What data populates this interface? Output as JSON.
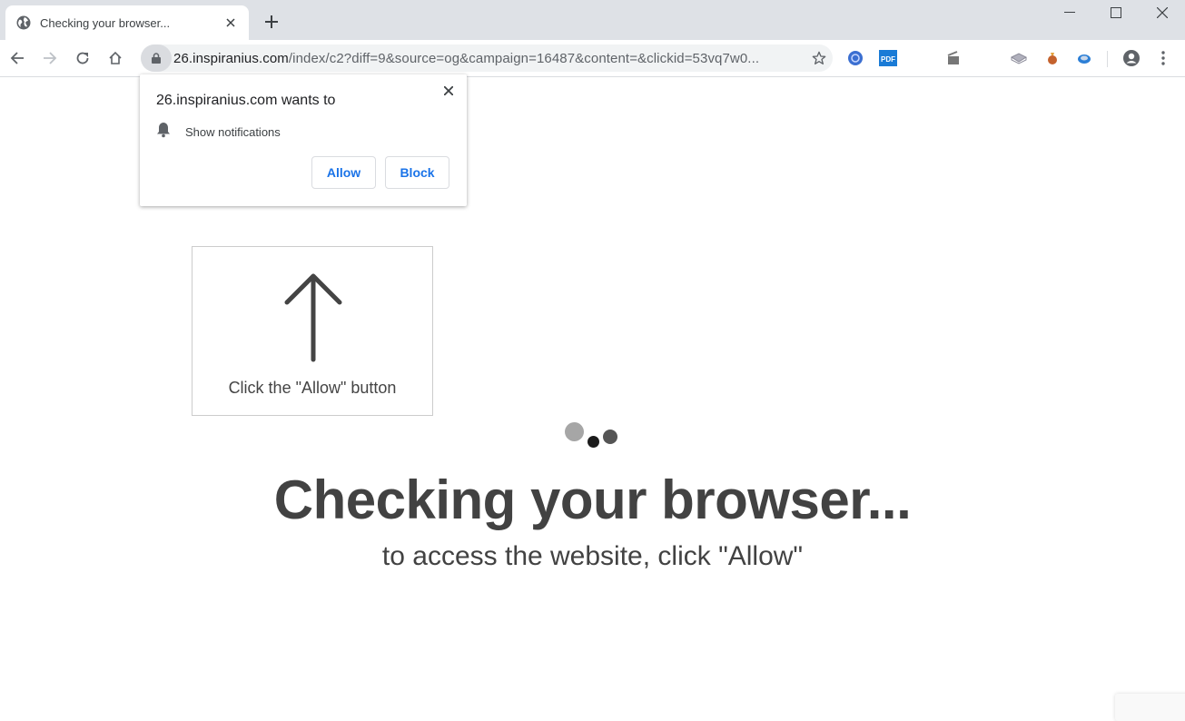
{
  "browser": {
    "tab": {
      "title": "Checking your browser...",
      "favicon": "globe-icon",
      "close_icon": "close-icon"
    },
    "new_tab_icon": "plus-icon",
    "window_controls": [
      "minimize-icon",
      "maximize-icon",
      "close-icon"
    ],
    "nav": [
      "back-icon",
      "forward-icon",
      "reload-icon",
      "home-icon"
    ],
    "address_bar": {
      "security_icon": "lock-icon",
      "host": "26.inspiranius.com",
      "path": "/index/c2?diff=9&source=og&campaign=16487&content=&clickid=53vq7w0...",
      "bookmark_icon": "star-icon"
    },
    "extensions": [
      {
        "name": "blue-globe-extension-icon",
        "color": "#3b6fd1"
      },
      {
        "name": "pdf-extension-icon",
        "label": "PDF",
        "color": "#1a7bd6"
      },
      {
        "name": "clapperboard-extension-icon",
        "color": "#777777"
      },
      {
        "name": "gray-box-extension-icon",
        "color": "#9a9aa8"
      },
      {
        "name": "money-bag-extension-icon",
        "color": "#c4622d"
      },
      {
        "name": "blue-disc-extension-icon",
        "color": "#2c7fd6"
      }
    ],
    "profile_icon": "account-circle-icon",
    "menu_icon": "kebab-menu-icon"
  },
  "permission_popup": {
    "title": "26.inspiranius.com wants to",
    "permission_icon": "bell-icon",
    "permission_label": "Show notifications",
    "allow_label": "Allow",
    "block_label": "Block",
    "accent_color": "#1a73e8"
  },
  "page": {
    "hint_text": "Click the \"Allow\" button",
    "headline": "Checking your browser...",
    "subtext": "to access the website, click \"Allow\"",
    "text_color": "#424242"
  }
}
